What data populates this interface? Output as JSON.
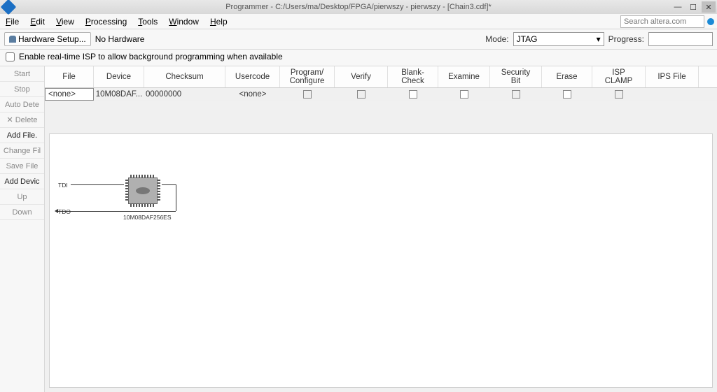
{
  "window": {
    "title": "Programmer - C:/Users/ma/Desktop/FPGA/pierwszy - pierwszy - [Chain3.cdf]*"
  },
  "menu": {
    "items": [
      {
        "label": "File",
        "ul": "F"
      },
      {
        "label": "Edit",
        "ul": "E"
      },
      {
        "label": "View",
        "ul": "V"
      },
      {
        "label": "Processing",
        "ul": "P"
      },
      {
        "label": "Tools",
        "ul": "T"
      },
      {
        "label": "Window",
        "ul": "W"
      },
      {
        "label": "Help",
        "ul": "H"
      }
    ],
    "search_placeholder": "Search altera.com"
  },
  "toolbar": {
    "hw_setup_label": "Hardware Setup...",
    "hw_status": "No Hardware",
    "mode_label": "Mode:",
    "mode_value": "JTAG",
    "progress_label": "Progress:"
  },
  "option": {
    "realtime_isp": "Enable real-time ISP to allow background programming when available"
  },
  "sidebar": {
    "items": [
      {
        "label": "Start",
        "enabled": false
      },
      {
        "label": "Stop",
        "enabled": false
      },
      {
        "label": "Auto Dete",
        "enabled": false
      },
      {
        "label": "✕ Delete",
        "enabled": false
      },
      {
        "label": "Add File.",
        "enabled": true
      },
      {
        "label": "Change Fil",
        "enabled": false
      },
      {
        "label": "Save File",
        "enabled": false
      },
      {
        "label": "Add Devic",
        "enabled": true
      },
      {
        "label": "Up",
        "enabled": false
      },
      {
        "label": "Down",
        "enabled": false
      }
    ]
  },
  "table": {
    "headers": [
      "File",
      "Device",
      "Checksum",
      "Usercode",
      "Program/\nConfigure",
      "Verify",
      "Blank-\nCheck",
      "Examine",
      "Security\nBit",
      "Erase",
      "ISP\nCLAMP",
      "IPS File"
    ],
    "row": {
      "file": "<none>",
      "device": "10M08DAF...",
      "checksum": "00000000",
      "usercode": "<none>"
    }
  },
  "diagram": {
    "tdi": "TDI",
    "tdo": "TDO",
    "chip_label": "10M08DAF256ES"
  }
}
